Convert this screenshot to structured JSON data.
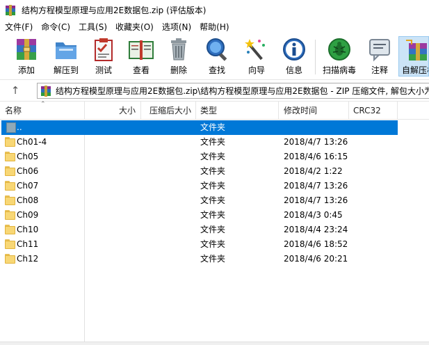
{
  "window": {
    "title": "结构方程模型原理与应用2E数据包.zip (评估版本)"
  },
  "menu": [
    {
      "label": "文件(F)"
    },
    {
      "label": "命令(C)"
    },
    {
      "label": "工具(S)"
    },
    {
      "label": "收藏夹(O)"
    },
    {
      "label": "选项(N)"
    },
    {
      "label": "帮助(H)"
    }
  ],
  "toolbar": [
    {
      "label": "添加",
      "icon": "add-archive-icon"
    },
    {
      "label": "解压到",
      "icon": "extract-to-icon"
    },
    {
      "label": "测试",
      "icon": "test-icon"
    },
    {
      "label": "查看",
      "icon": "view-icon"
    },
    {
      "label": "删除",
      "icon": "delete-icon"
    },
    {
      "label": "查找",
      "icon": "find-icon"
    },
    {
      "label": "向导",
      "icon": "wizard-icon"
    },
    {
      "label": "信息",
      "icon": "info-icon"
    },
    {
      "label": "扫描病毒",
      "icon": "virus-scan-icon"
    },
    {
      "label": "注释",
      "icon": "comment-icon"
    },
    {
      "label": "自解压格",
      "icon": "sfx-icon"
    }
  ],
  "address": {
    "path": "结构方程模型原理与应用2E数据包.zip\\结构方程模型原理与应用2E数据包 - ZIP 压缩文件, 解包大小为"
  },
  "columns": {
    "name": "名称",
    "size": "大小",
    "packed": "压缩后大小",
    "type": "类型",
    "modified": "修改时间",
    "crc": "CRC32"
  },
  "files": [
    {
      "name": "..",
      "type": "文件夹",
      "modified": "",
      "selected": true,
      "kind": "parent"
    },
    {
      "name": "Ch01-4",
      "type": "文件夹",
      "modified": "2018/4/7 13:26"
    },
    {
      "name": "Ch05",
      "type": "文件夹",
      "modified": "2018/4/6 16:15"
    },
    {
      "name": "Ch06",
      "type": "文件夹",
      "modified": "2018/4/2 1:22"
    },
    {
      "name": "Ch07",
      "type": "文件夹",
      "modified": "2018/4/7 13:26"
    },
    {
      "name": "Ch08",
      "type": "文件夹",
      "modified": "2018/4/7 13:26"
    },
    {
      "name": "Ch09",
      "type": "文件夹",
      "modified": "2018/4/3 0:45"
    },
    {
      "name": "Ch10",
      "type": "文件夹",
      "modified": "2018/4/4 23:24"
    },
    {
      "name": "Ch11",
      "type": "文件夹",
      "modified": "2018/4/6 18:52"
    },
    {
      "name": "Ch12",
      "type": "文件夹",
      "modified": "2018/4/6 20:21"
    }
  ],
  "colors": {
    "selection": "#0078d7",
    "folder": "#f8d775",
    "active_tool": "#cce4f7"
  }
}
